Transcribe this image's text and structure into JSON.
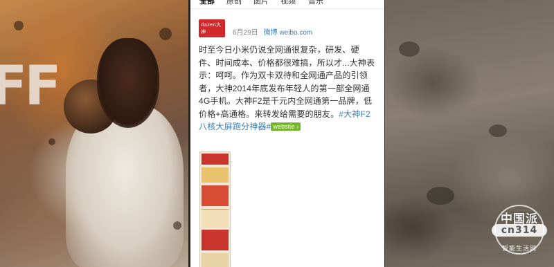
{
  "tabs": [
    {
      "label": "全部"
    },
    {
      "label": "原创"
    },
    {
      "label": "图片"
    },
    {
      "label": "视频"
    },
    {
      "label": "音乐"
    }
  ],
  "post": {
    "avatar_brand": "dazen大神",
    "date": "6月29日",
    "source": "微博 weibo.com",
    "body": "时至今日小米仍说全网通很复杂，研发、硬件、时间成本、价格都很难搞，所以才...大神表示：呵呵。作为双卡双待和全网通产品的引领者，大神2014年底发布年轻人的第一部全网通4G手机。大神F2是千元内全网通第一品牌，低价格+高通格。来转发给需要的朋友。",
    "hashtag": "#大神F2八核大屏跑分神器#",
    "link_badge": "website ›"
  },
  "background": {
    "left_letters": "FF"
  },
  "watermark": {
    "title": "中国派",
    "code": "cn314",
    "subtitle": "智能生活网"
  },
  "colors": {
    "link_blue": "#3b7fb8",
    "badge_green": "#76b62d",
    "brand_red": "#d1282b"
  }
}
